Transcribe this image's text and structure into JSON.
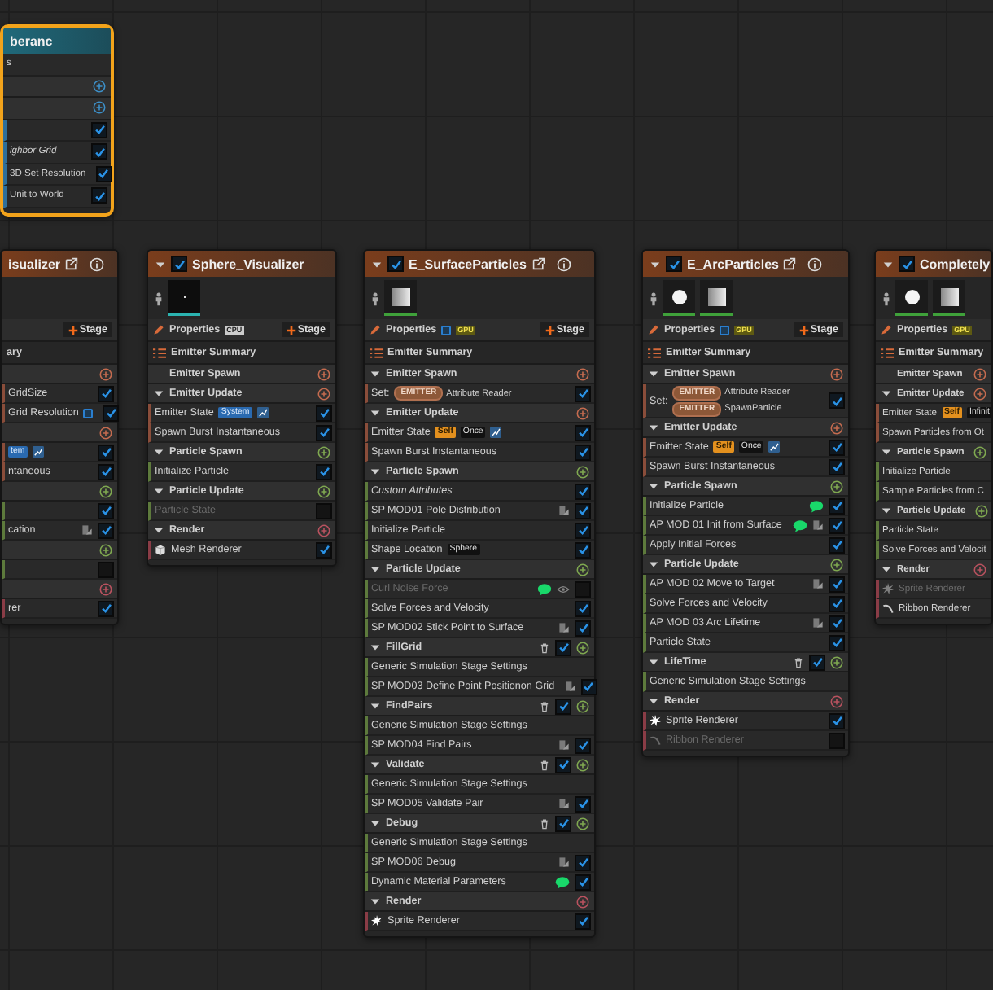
{
  "nodes": [
    {
      "kind": "system",
      "title": "beranc",
      "selected": true,
      "rows": [
        {
          "kind": "text",
          "label": "s"
        },
        {
          "kind": "system_stage"
        },
        {
          "kind": "system_stage"
        },
        {
          "kind": "module",
          "checked": true
        },
        {
          "kind": "module",
          "label": "ighbor Grid",
          "italic": true,
          "checked": true
        },
        {
          "kind": "module",
          "label": "3D Set Resolution",
          "checked": true
        },
        {
          "kind": "module",
          "label": "Unit to World",
          "checked": true
        }
      ]
    },
    {
      "kind": "emitter",
      "title": "isualizer",
      "selected": false,
      "title_icons": true,
      "stage_button": "Stage",
      "summary": "ary",
      "rows": [
        {
          "kind": "emitter_stage"
        },
        {
          "kind": "module",
          "label": "GridSize",
          "checked": true
        },
        {
          "kind": "module",
          "label": "Grid Resolution",
          "dot": true,
          "checked": true
        },
        {
          "kind": "emitter_stage"
        },
        {
          "kind": "module",
          "tags": [
            {
              "text": "tem",
              "kind": "system"
            }
          ],
          "graph": true,
          "checked": true
        },
        {
          "kind": "module",
          "label": "ntaneous",
          "checked": true
        },
        {
          "kind": "particle_stage"
        },
        {
          "kind": "module",
          "checked": true
        },
        {
          "kind": "module",
          "label": "cation",
          "local": true,
          "checked": true
        },
        {
          "kind": "particle_stage"
        },
        {
          "kind": "module",
          "checked": false
        },
        {
          "kind": "render_stage"
        },
        {
          "kind": "module",
          "label": "rer",
          "checked": true
        }
      ]
    },
    {
      "kind": "emitter",
      "title": "Sphere_Visualizer",
      "selected": false,
      "enabled": true,
      "expanded": true,
      "title_icons": false,
      "thumbnails": [
        {
          "kind": "dark"
        }
      ],
      "properties": {
        "label": "Properties",
        "badge": "CPU"
      },
      "stage_button": "Stage",
      "summary": "Emitter Summary",
      "rows": [
        {
          "kind": "emitter_stage",
          "label": "Emitter Spawn",
          "expanded": false
        },
        {
          "kind": "emitter_stage",
          "label": "Emitter Update",
          "expanded": true
        },
        {
          "kind": "module",
          "label": "Emitter State",
          "tags": [
            {
              "text": "System",
              "kind": "system"
            }
          ],
          "graph": true,
          "checked": true
        },
        {
          "kind": "module",
          "label": "Spawn Burst Instantaneous",
          "checked": true
        },
        {
          "kind": "particle_stage",
          "label": "Particle Spawn",
          "expanded": true
        },
        {
          "kind": "module",
          "label": "Initialize Particle",
          "checked": true
        },
        {
          "kind": "particle_stage",
          "label": "Particle Update",
          "expanded": true
        },
        {
          "kind": "module",
          "label": "Particle State",
          "disabled": true,
          "checked": false
        },
        {
          "kind": "render_stage",
          "label": "Render",
          "expanded": true
        },
        {
          "kind": "mesh_renderer",
          "label": "Mesh Renderer",
          "checked": true
        }
      ]
    },
    {
      "kind": "emitter",
      "title": "E_SurfaceParticles",
      "selected": false,
      "enabled": true,
      "expanded": true,
      "title_icons": true,
      "thumbnails": [
        {
          "kind": "cube"
        }
      ],
      "properties": {
        "label": "Properties",
        "dot": true,
        "badge": "GPU"
      },
      "stage_button": "Stage",
      "summary": "Emitter Summary",
      "rows": [
        {
          "kind": "emitter_stage",
          "label": "Emitter Spawn",
          "expanded": true
        },
        {
          "kind": "set",
          "prefix": "Set:",
          "entries": [
            {
              "tag": "EMITTER",
              "label": "Attribute Reader"
            }
          ],
          "checked": true
        },
        {
          "kind": "emitter_stage",
          "label": "Emitter Update",
          "expanded": true
        },
        {
          "kind": "module",
          "label": "Emitter State",
          "tags": [
            {
              "text": "Self",
              "kind": "self"
            },
            {
              "text": "Once",
              "kind": "plain"
            }
          ],
          "graph": true,
          "checked": true
        },
        {
          "kind": "module",
          "label": "Spawn Burst Instantaneous",
          "checked": true
        },
        {
          "kind": "particle_stage",
          "label": "Particle Spawn",
          "expanded": true
        },
        {
          "kind": "module",
          "label": "Custom Attributes",
          "italic": true,
          "checked": true
        },
        {
          "kind": "module",
          "label": "SP MOD01 Pole Distribution",
          "local": true,
          "checked": true
        },
        {
          "kind": "module",
          "label": "Initialize Particle",
          "checked": true
        },
        {
          "kind": "module",
          "label": "Shape Location",
          "tags": [
            {
              "text": "Sphere",
              "kind": "plain"
            }
          ],
          "checked": true
        },
        {
          "kind": "particle_stage",
          "label": "Particle Update",
          "expanded": true
        },
        {
          "kind": "module",
          "label": "Curl Noise Force",
          "disabled": true,
          "note": true,
          "eye": true,
          "checked": false
        },
        {
          "kind": "module",
          "label": "Solve Forces and Velocity",
          "checked": true
        },
        {
          "kind": "module",
          "label": "SP MOD02 Stick Point to Surface",
          "local": true,
          "checked": true
        },
        {
          "kind": "sim_stage",
          "label": "FillGrid",
          "expanded": true,
          "checked": true
        },
        {
          "kind": "module",
          "label": "Generic Simulation Stage Settings"
        },
        {
          "kind": "module",
          "label": "SP MOD03 Define Point Positionon Grid",
          "local": true,
          "checked": true
        },
        {
          "kind": "sim_stage",
          "label": "FindPairs",
          "expanded": true,
          "checked": true
        },
        {
          "kind": "module",
          "label": "Generic Simulation Stage Settings"
        },
        {
          "kind": "module",
          "label": "SP MOD04 Find Pairs",
          "local": true,
          "checked": true
        },
        {
          "kind": "sim_stage",
          "label": "Validate",
          "expanded": true,
          "checked": true
        },
        {
          "kind": "module",
          "label": "Generic Simulation Stage Settings"
        },
        {
          "kind": "module",
          "label": "SP MOD05 Validate Pair",
          "local": true,
          "checked": true
        },
        {
          "kind": "sim_stage",
          "label": "Debug",
          "expanded": true,
          "checked": true
        },
        {
          "kind": "module",
          "label": "Generic Simulation Stage Settings"
        },
        {
          "kind": "module",
          "label": "SP MOD06 Debug",
          "local": true,
          "checked": true
        },
        {
          "kind": "module",
          "label": "Dynamic Material Parameters",
          "note": true,
          "checked": true
        },
        {
          "kind": "render_stage",
          "label": "Render",
          "expanded": true
        },
        {
          "kind": "sprite_renderer",
          "label": "Sprite Renderer",
          "checked": true
        }
      ]
    },
    {
      "kind": "emitter",
      "title": "E_ArcParticles",
      "selected": false,
      "enabled": true,
      "expanded": true,
      "title_icons": true,
      "thumbnails": [
        {
          "kind": "sphere"
        },
        {
          "kind": "cube"
        }
      ],
      "properties": {
        "label": "Properties",
        "dot": true,
        "badge": "GPU"
      },
      "stage_button": "Stage",
      "summary": "Emitter Summary",
      "rows": [
        {
          "kind": "emitter_stage",
          "label": "Emitter Spawn",
          "expanded": true
        },
        {
          "kind": "set",
          "prefix": "Set:",
          "entries": [
            {
              "tag": "EMITTER",
              "label": "Attribute Reader"
            },
            {
              "tag": "EMITTER",
              "label": "SpawnParticle"
            }
          ],
          "checked": true
        },
        {
          "kind": "emitter_stage",
          "label": "Emitter Update",
          "expanded": true
        },
        {
          "kind": "module",
          "label": "Emitter State",
          "tags": [
            {
              "text": "Self",
              "kind": "self"
            },
            {
              "text": "Once",
              "kind": "plain"
            }
          ],
          "graph": true,
          "checked": true
        },
        {
          "kind": "module",
          "label": "Spawn Burst Instantaneous",
          "checked": true
        },
        {
          "kind": "particle_stage",
          "label": "Particle Spawn",
          "expanded": true
        },
        {
          "kind": "module",
          "label": "Initialize Particle",
          "note": true,
          "checked": true
        },
        {
          "kind": "module",
          "label": "AP MOD 01 Init from Surface",
          "note": true,
          "local": true,
          "checked": true
        },
        {
          "kind": "module",
          "label": "Apply Initial Forces",
          "checked": true
        },
        {
          "kind": "particle_stage",
          "label": "Particle Update",
          "expanded": true
        },
        {
          "kind": "module",
          "label": "AP MOD 02 Move to Target",
          "local": true,
          "checked": true
        },
        {
          "kind": "module",
          "label": "Solve Forces and Velocity",
          "checked": true
        },
        {
          "kind": "module",
          "label": "AP MOD 03 Arc Lifetime",
          "local": true,
          "checked": true
        },
        {
          "kind": "module",
          "label": "Particle State",
          "checked": true
        },
        {
          "kind": "sim_stage",
          "label": "LifeTime",
          "expanded": true,
          "checked": true
        },
        {
          "kind": "module",
          "label": "Generic Simulation Stage Settings"
        },
        {
          "kind": "render_stage",
          "label": "Render",
          "expanded": true
        },
        {
          "kind": "sprite_renderer",
          "label": "Sprite Renderer",
          "checked": true
        },
        {
          "kind": "ribbon_renderer",
          "label": "Ribbon Renderer",
          "disabled": true,
          "checked": false
        }
      ]
    },
    {
      "kind": "emitter",
      "title": "Completely",
      "selected": false,
      "enabled": true,
      "expanded": true,
      "thumbnails": [
        {
          "kind": "sphere"
        },
        {
          "kind": "cube"
        }
      ],
      "properties": {
        "label": "Properties",
        "badge": "GPU"
      },
      "summary": "Emitter Summary",
      "rows": [
        {
          "kind": "emitter_stage",
          "label": "Emitter Spawn",
          "expanded": false
        },
        {
          "kind": "emitter_stage",
          "label": "Emitter Update",
          "expanded": true
        },
        {
          "kind": "module",
          "label": "Emitter State",
          "tags": [
            {
              "text": "Self",
              "kind": "self"
            },
            {
              "text": "Infinit",
              "kind": "plain"
            }
          ]
        },
        {
          "kind": "module",
          "label": "Spawn Particles from Ot"
        },
        {
          "kind": "particle_stage",
          "label": "Particle Spawn",
          "expanded": true
        },
        {
          "kind": "module",
          "label": "Initialize Particle"
        },
        {
          "kind": "module",
          "label": "Sample Particles from C"
        },
        {
          "kind": "particle_stage",
          "label": "Particle Update",
          "expanded": true
        },
        {
          "kind": "module",
          "label": "Particle State"
        },
        {
          "kind": "module",
          "label": "Solve Forces and Velocit"
        },
        {
          "kind": "render_stage",
          "label": "Render",
          "expanded": true
        },
        {
          "kind": "sprite_renderer",
          "label": "Sprite Renderer",
          "disabled": true
        },
        {
          "kind": "ribbon_renderer",
          "label": "Ribbon Renderer",
          "disabled": false
        }
      ]
    }
  ]
}
